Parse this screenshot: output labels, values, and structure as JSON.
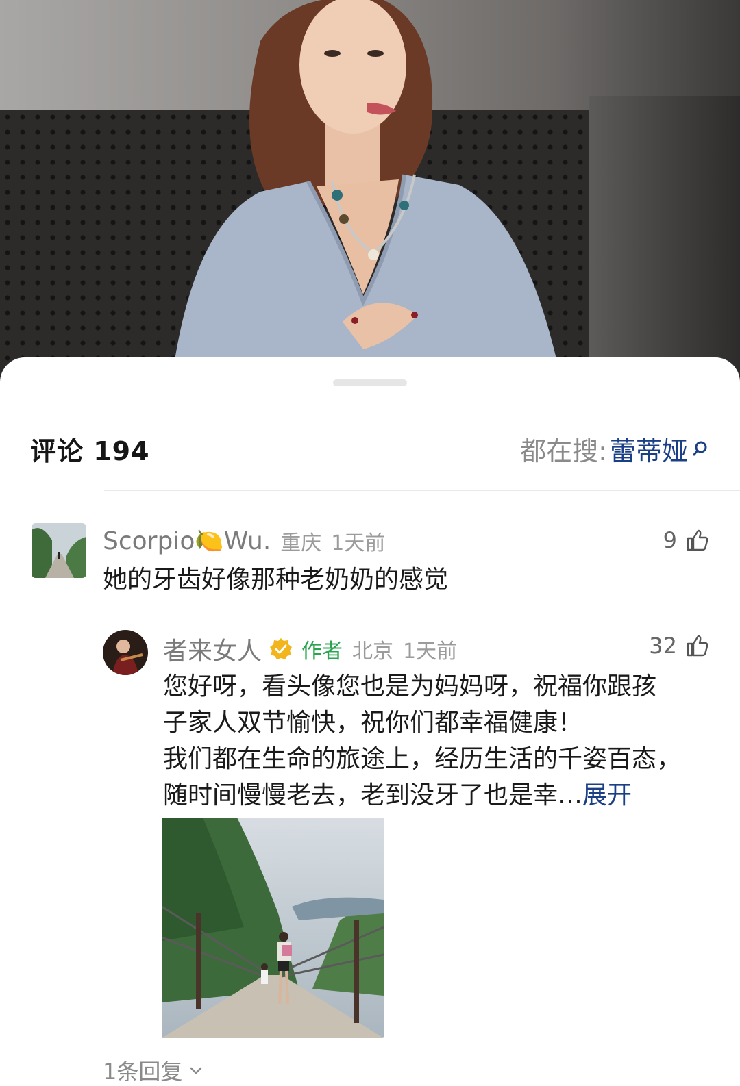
{
  "comments_header": {
    "title": "评论 194",
    "search_prefix": "都在搜:",
    "search_keyword": "蕾蒂娅"
  },
  "comments": [
    {
      "username_left": "Scorpio",
      "username_emoji": "🍋",
      "username_right": "Wu.",
      "location": "重庆",
      "time": "1天前",
      "likes": "9",
      "text": "她的牙齿好像那种老奶奶的感觉"
    }
  ],
  "reply": {
    "username": "者来女人",
    "badge": "作者",
    "location": "北京",
    "time": "1天前",
    "likes": "32",
    "lines": [
      "您好呀，看头像您也是为妈妈呀，祝福你跟孩",
      "子家人双节愉快，祝你们都幸福健康！",
      "我们都在生命的旅途上，经历生活的千姿百态，",
      "随时间慢慢老去，老到没牙了也是幸…"
    ],
    "expand_label": "展开"
  },
  "replies_footer": "1条回复",
  "colors": {
    "link_blue": "#1b3f86",
    "author_green": "#2aa44f",
    "verified_gold": "#f2b51c"
  },
  "icons": [
    "search-icon",
    "thumbs-up-icon",
    "verified-badge-icon",
    "chevron-down-icon"
  ]
}
